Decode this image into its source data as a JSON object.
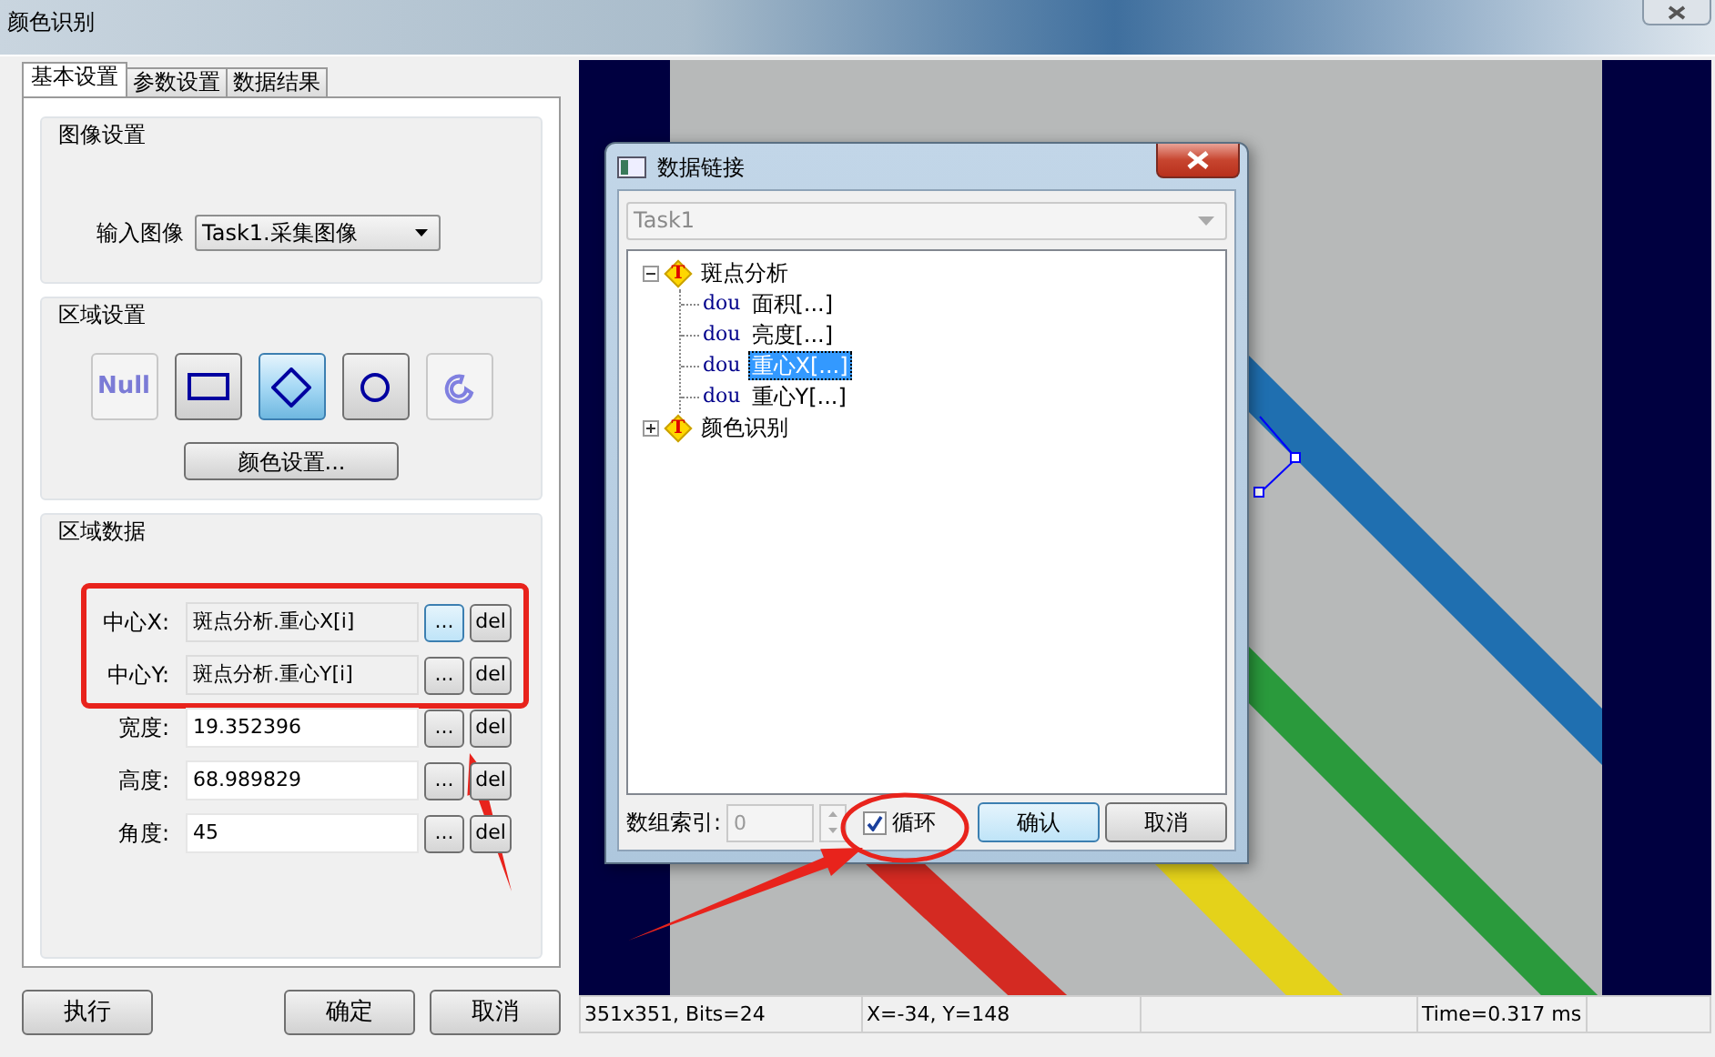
{
  "window": {
    "title": "颜色识别"
  },
  "tabs": [
    {
      "label": "基本设置",
      "selected": true
    },
    {
      "label": "参数设置",
      "selected": false
    },
    {
      "label": "数据结果",
      "selected": false
    }
  ],
  "image_settings": {
    "title": "图像设置",
    "input_label": "输入图像",
    "input_value": "Task1.采集图像"
  },
  "region_settings": {
    "title": "区域设置",
    "shapes": [
      {
        "kind": "null",
        "label": "Null",
        "selected": false,
        "disabled": true
      },
      {
        "kind": "rectangle",
        "selected": false,
        "disabled": false
      },
      {
        "kind": "diamond",
        "selected": true,
        "disabled": false
      },
      {
        "kind": "circle",
        "selected": false,
        "disabled": false
      },
      {
        "kind": "arc",
        "selected": false,
        "disabled": true
      }
    ],
    "color_button": "颜色设置..."
  },
  "region_data": {
    "title": "区域数据",
    "fields": [
      {
        "label": "中心X:",
        "value": "斑点分析.重心X[i]",
        "linked": true,
        "browse": "...",
        "browse_focused": true,
        "delete": "del"
      },
      {
        "label": "中心Y:",
        "value": "斑点分析.重心Y[i]",
        "linked": true,
        "browse": "...",
        "browse_focused": false,
        "delete": "del"
      },
      {
        "label": "宽度:",
        "value": "19.352396",
        "linked": false,
        "browse": "...",
        "browse_focused": false,
        "delete": "del"
      },
      {
        "label": "高度:",
        "value": "68.989829",
        "linked": false,
        "browse": "...",
        "browse_focused": false,
        "delete": "del"
      },
      {
        "label": "角度:",
        "value": "45",
        "linked": false,
        "browse": "...",
        "browse_focused": false,
        "delete": "del"
      }
    ]
  },
  "footer_buttons": [
    "执行",
    "确定",
    "取消"
  ],
  "status_bar": {
    "size": "351x351, Bits=24",
    "position": "X=-34, Y=148",
    "time": "Time=0.317 ms"
  },
  "dialog": {
    "title": "数据链接",
    "task_select": "Task1",
    "tree": [
      {
        "badge": "T",
        "label": "斑点分析",
        "expanded": true,
        "children": [
          {
            "type": "dou",
            "label": "面积[...]",
            "selected": false
          },
          {
            "type": "dou",
            "label": "亮度[...]",
            "selected": false
          },
          {
            "type": "dou",
            "label": "重心X[...]",
            "selected": true
          },
          {
            "type": "dou",
            "label": "重心Y[...]",
            "selected": false
          }
        ]
      },
      {
        "badge": "T",
        "label": "颜色识别",
        "expanded": false
      }
    ],
    "index_label": "数组索引:",
    "index_value": "0",
    "loop": {
      "label": "循环",
      "checked": true
    },
    "buttons": [
      "确认",
      "取消"
    ]
  },
  "annotations": [
    {
      "kind": "box"
    },
    {
      "kind": "arrow"
    },
    {
      "kind": "ellipse"
    },
    {
      "kind": "arrow"
    }
  ]
}
